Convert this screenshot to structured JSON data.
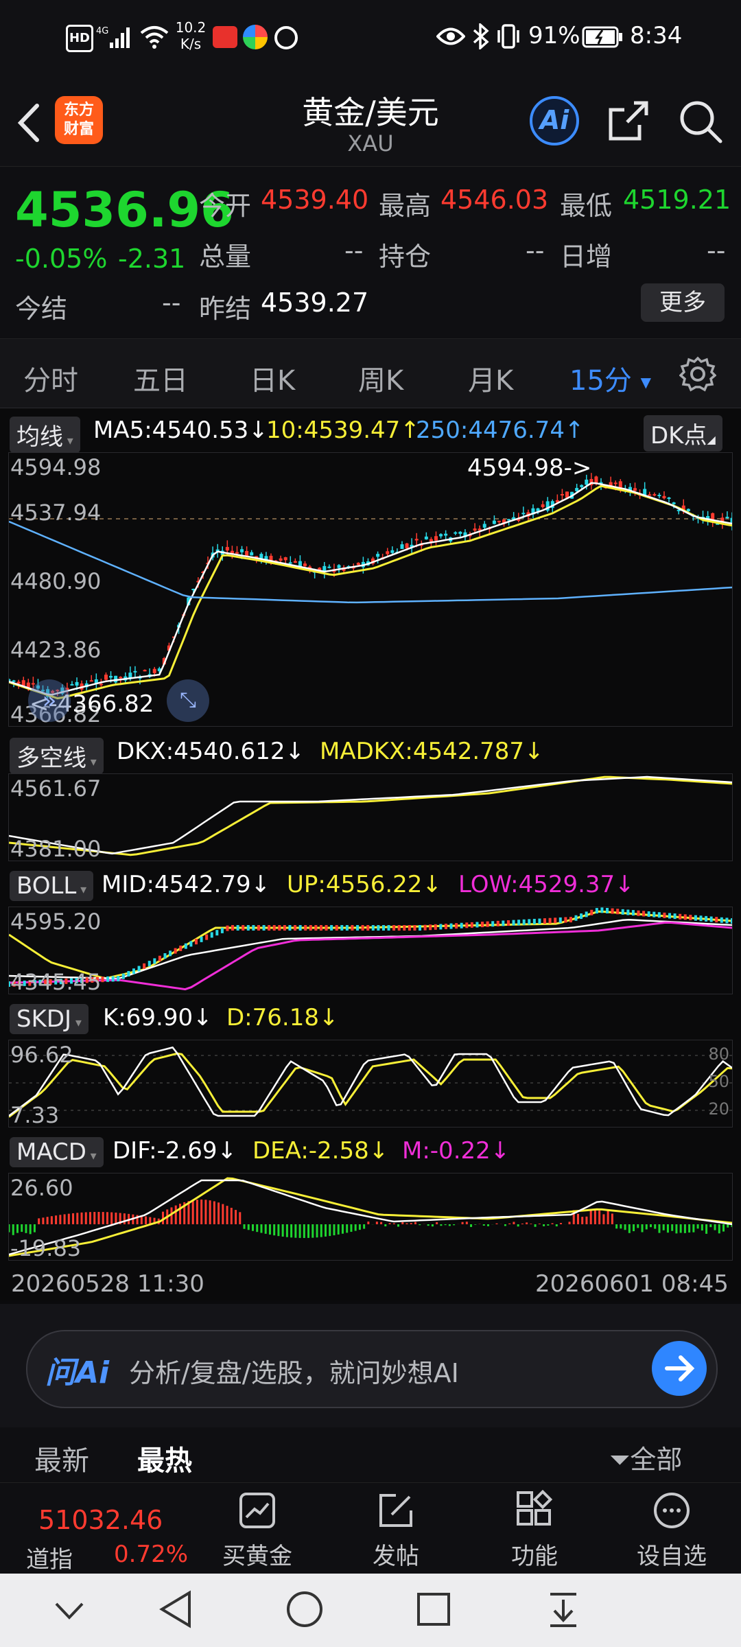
{
  "status_bar": {
    "left_icons": [
      "hd-icon",
      "4g-signal-icon",
      "wifi-icon"
    ],
    "speed_value": "10.2",
    "speed_unit": "K/s",
    "battery_pct": "91%",
    "time": "8:34"
  },
  "header": {
    "logo_line1": "东方",
    "logo_line2": "财富",
    "title": "黄金/美元",
    "subtitle": "XAU",
    "ai_label": "Ai"
  },
  "quote": {
    "price": "4536.96",
    "change_pct": "-0.05%",
    "change": "-2.31",
    "open_label": "今开",
    "open": "4539.40",
    "high_label": "最高",
    "high": "4546.03",
    "low_label": "最低",
    "low": "4519.21",
    "volume_label": "总量",
    "volume": "--",
    "oi_label": "持仓",
    "oi": "--",
    "daily_inc_label": "日增",
    "daily_inc": "--",
    "settle_label": "今结",
    "settle": "--",
    "prev_settle_label": "昨结",
    "prev_settle": "4539.27",
    "more_button": "更多"
  },
  "tabs": {
    "items": [
      "分时",
      "五日",
      "日K",
      "周K",
      "月K",
      "15分"
    ],
    "active": "15分"
  },
  "main_chart": {
    "tag": "均线",
    "ma5": "MA5:4540.53",
    "ma10": "10:4539.47",
    "ma250": "250:4476.74",
    "dk_button": "DK点",
    "y_labels": [
      "4594.98",
      "4537.94",
      "4480.90",
      "4423.86",
      "4366.82"
    ],
    "high_marker": "4594.98->",
    "low_marker": "<-4366.82"
  },
  "dkx": {
    "tag": "多空线",
    "dkx": "DKX:4540.612",
    "madkx": "MADKX:4542.787",
    "y_labels": [
      "4561.67",
      "4381.00"
    ]
  },
  "boll": {
    "tag": "BOLL",
    "mid": "MID:4542.79",
    "up": "UP:4556.22",
    "low": "LOW:4529.37",
    "y_labels": [
      "4595.20",
      "4345.45"
    ]
  },
  "skdj": {
    "tag": "SKDJ",
    "k": "K:69.90",
    "d": "D:76.18",
    "y_labels": [
      "96.62",
      "7.33"
    ],
    "right_labels": [
      "80",
      "50",
      "20"
    ]
  },
  "macd": {
    "tag": "MACD",
    "dif": "DIF:-2.69",
    "dea": "DEA:-2.58",
    "m": "M:-0.22",
    "y_labels": [
      "26.60",
      "-19.83"
    ]
  },
  "time_axis": {
    "start": "20260528 11:30",
    "end": "20260601 08:45"
  },
  "ai_bar": {
    "brand": "问Ai",
    "placeholder": "分析/复盘/选股，就问妙想AI"
  },
  "news_tabs": {
    "latest": "最新",
    "hot": "最热",
    "filter": "全部"
  },
  "toolbar": {
    "index_value": "51032.46",
    "index_name": "道指",
    "index_change": "0.72%",
    "buy_gold": "买黄金",
    "post": "发帖",
    "functions": "功能",
    "watchlist": "设自选"
  }
}
